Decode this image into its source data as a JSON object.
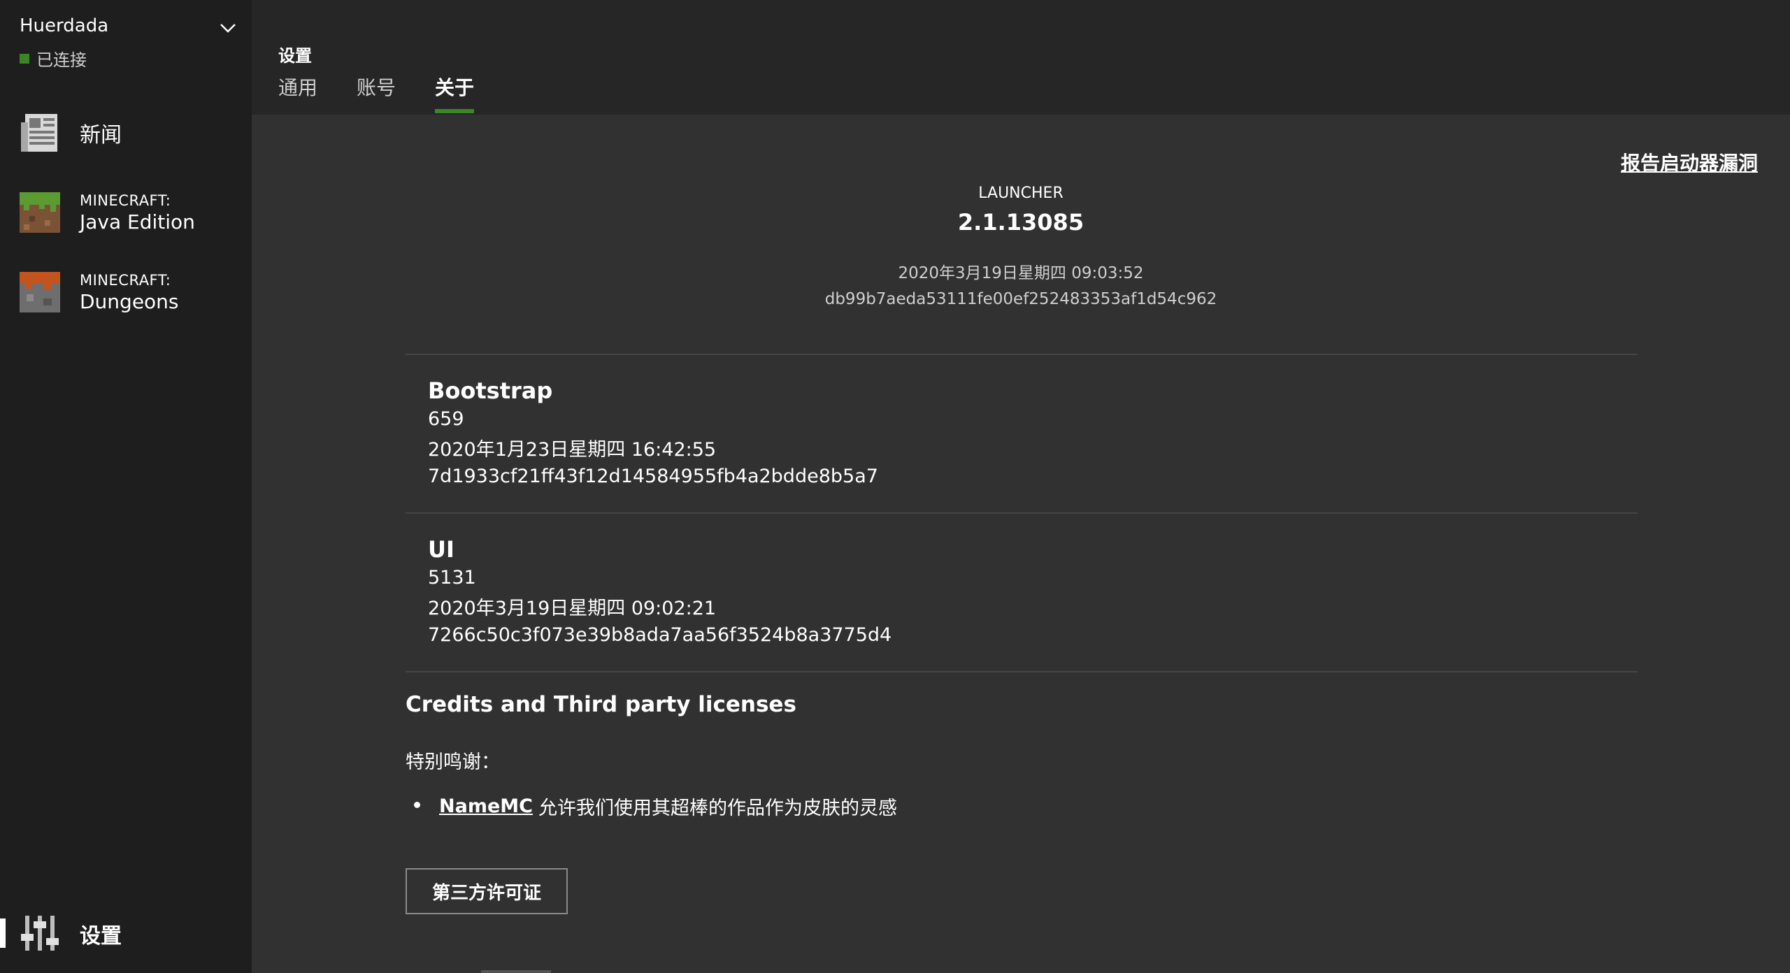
{
  "account": {
    "name": "Huerdada",
    "status": "已连接",
    "status_color": "#3c8527"
  },
  "sidebar": {
    "items": [
      {
        "label": "新闻",
        "icon": "newspaper-icon"
      },
      {
        "label_small": "MINECRAFT:",
        "label": "Java Edition",
        "icon": "grass-block-icon"
      },
      {
        "label_small": "MINECRAFT:",
        "label": "Dungeons",
        "icon": "dungeons-block-icon"
      }
    ],
    "settings_label": "设置",
    "settings_icon": "sliders-icon"
  },
  "header": {
    "title": "设置",
    "tabs": [
      {
        "label": "通用",
        "active": false
      },
      {
        "label": "账号",
        "active": false
      },
      {
        "label": "关于",
        "active": true
      }
    ],
    "accent_color": "#3c8527"
  },
  "about": {
    "report_link": "报告启动器漏洞",
    "launcher": {
      "label": "LAUNCHER",
      "version": "2.1.13085",
      "date": "2020年3月19日星期四 09:03:52",
      "hash": "db99b7aeda53111fe00ef252483353af1d54c962"
    },
    "bootstrap": {
      "title": "Bootstrap",
      "build": "659",
      "date": "2020年1月23日星期四 16:42:55",
      "hash": "7d1933cf21ff43f12d14584955fb4a2bdde8b5a7"
    },
    "ui": {
      "title": "UI",
      "build": "5131",
      "date": "2020年3月19日星期四 09:02:21",
      "hash": "7266c50c3f073e39b8ada7aa56f3524b8a3775d4"
    },
    "credits": {
      "title": "Credits and Third party licenses",
      "thanks_label": "特别鸣谢：",
      "items": [
        {
          "link": "NameMC",
          "text": "允许我们使用其超棒的作品作为皮肤的灵感"
        }
      ],
      "license_button": "第三方许可证"
    }
  }
}
